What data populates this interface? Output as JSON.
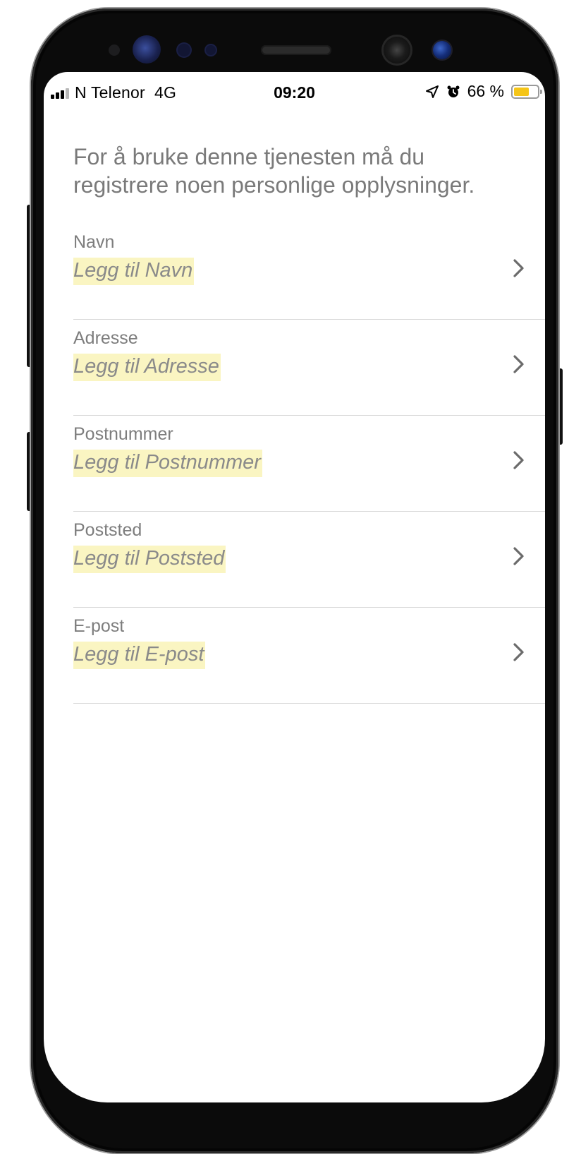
{
  "status_bar": {
    "carrier": "N Telenor",
    "network": "4G",
    "time": "09:20",
    "battery_text": "66 %",
    "battery_level": 0.66,
    "battery_color": "#f5c518",
    "icons": [
      "signal-icon",
      "location-icon",
      "alarm-icon",
      "battery-icon"
    ]
  },
  "intro": {
    "text": "For å bruke denne tjenesten må du registrere noen personlige opplysninger."
  },
  "fields": [
    {
      "label": "Navn",
      "value": "Legg til Navn"
    },
    {
      "label": "Adresse",
      "value": "Legg til Adresse"
    },
    {
      "label": "Postnummer",
      "value": "Legg til Postnummer"
    },
    {
      "label": "Poststed",
      "value": "Legg til Poststed"
    },
    {
      "label": "E-post",
      "value": "Legg til E-post"
    }
  ],
  "colors": {
    "highlight": "#faf5c2",
    "text_gray": "#7a7a7a",
    "divider": "#d8d8d8"
  }
}
